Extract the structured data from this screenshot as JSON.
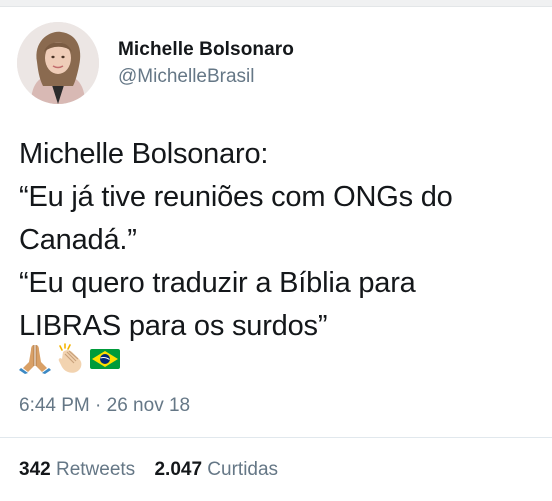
{
  "author": {
    "name": "Michelle Bolsonaro",
    "handle": "@MichelleBrasil"
  },
  "tweet": {
    "lines": [
      "Michelle Bolsonaro:",
      "“Eu já tive reuniões com ONGs do",
      "Canadá.”",
      "“Eu quero traduzir a Bíblia para",
      "LIBRAS para os surdos”"
    ],
    "emojis": [
      "praying-hands-icon",
      "clapping-hands-icon",
      "brazil-flag-icon"
    ]
  },
  "timestamp": "6:44 PM · 26 nov 18",
  "stats": {
    "retweets_count": "342",
    "retweets_label": "Retweets",
    "likes_count": "2.047",
    "likes_label": "Curtidas"
  },
  "colors": {
    "text": "#14171a",
    "secondary": "#657786",
    "divider": "#e1e8ed"
  }
}
